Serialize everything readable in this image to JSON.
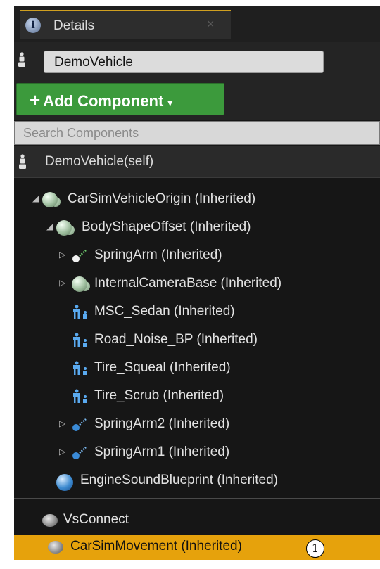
{
  "tab": {
    "title": "Details",
    "close_glyph": "×",
    "icon": "info-icon",
    "icon_glyph": "i"
  },
  "actor_name": "DemoVehicle",
  "add_component": {
    "plus": "+",
    "label": "Add Component",
    "caret": "▾"
  },
  "search": {
    "placeholder": "Search Components"
  },
  "self_row": {
    "label": "DemoVehicle(self)",
    "icon": "actor-icon"
  },
  "tree": [
    {
      "label": "CarSimVehicleOrigin (Inherited)",
      "icon": "scene-component-icon",
      "arrow": "◢",
      "depth": 0
    },
    {
      "label": "BodyShapeOffset (Inherited)",
      "icon": "scene-component-icon",
      "arrow": "◢",
      "depth": 1
    },
    {
      "label": "SpringArm (Inherited)",
      "icon": "spring-arm-icon",
      "arrow": "▷",
      "depth": 2
    },
    {
      "label": "InternalCameraBase (Inherited)",
      "icon": "scene-component-icon",
      "arrow": "▷",
      "depth": 2
    },
    {
      "label": "MSC_Sedan (Inherited)",
      "icon": "child-actor-icon",
      "arrow": "",
      "depth": 2
    },
    {
      "label": "Road_Noise_BP (Inherited)",
      "icon": "child-actor-icon",
      "arrow": "",
      "depth": 2
    },
    {
      "label": "Tire_Squeal (Inherited)",
      "icon": "child-actor-icon",
      "arrow": "",
      "depth": 2
    },
    {
      "label": "Tire_Scrub (Inherited)",
      "icon": "child-actor-icon",
      "arrow": "",
      "depth": 2
    },
    {
      "label": "SpringArm2 (Inherited)",
      "icon": "spring-arm-icon",
      "arrow": "▷",
      "depth": 2
    },
    {
      "label": "SpringArm1 (Inherited)",
      "icon": "spring-arm-icon",
      "arrow": "▷",
      "depth": 2
    },
    {
      "label": "EngineSoundBlueprint (Inherited)",
      "icon": "blueprint-component-icon",
      "arrow": "",
      "depth": 1
    }
  ],
  "components": [
    {
      "label": "VsConnect",
      "icon": "actor-component-icon",
      "selected": false
    },
    {
      "label": "CarSimMovement (Inherited)",
      "icon": "actor-component-icon",
      "selected": true
    }
  ],
  "callout": "1",
  "colors": {
    "selected_row": "#e6a20c",
    "add_button": "#3c9a3c",
    "panel_bg": "#161616"
  }
}
